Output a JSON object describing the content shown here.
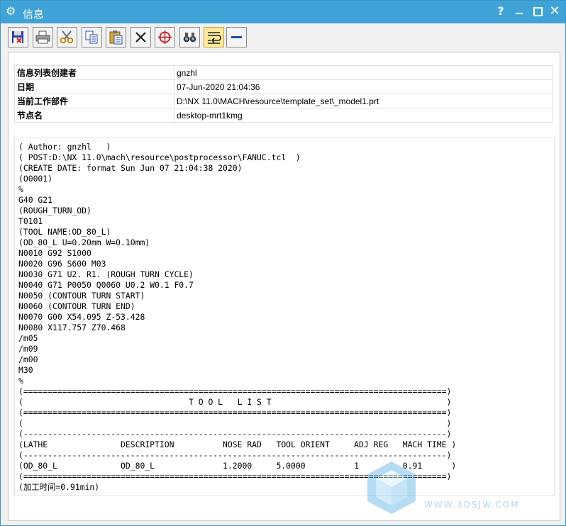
{
  "window": {
    "title": "信息",
    "help_label": "?",
    "close_label": "✕"
  },
  "toolbar": {
    "buttons": [
      {
        "name": "save-button",
        "icon": "floppy-disk-icon"
      },
      {
        "name": "print-button",
        "icon": "printer-icon"
      },
      {
        "name": "cut-button",
        "icon": "scissors-icon"
      },
      {
        "name": "copy-button",
        "icon": "copy-icon"
      },
      {
        "name": "paste-button",
        "icon": "clipboard-icon"
      },
      {
        "name": "delete-button",
        "icon": "x-icon"
      },
      {
        "name": "target-button",
        "icon": "crosshair-icon"
      },
      {
        "name": "find-button",
        "icon": "binoculars-icon"
      },
      {
        "name": "wrap-button",
        "icon": "word-wrap-icon",
        "active": true
      },
      {
        "name": "minimize-panel-button",
        "icon": "minus-icon"
      }
    ]
  },
  "info": {
    "rows": [
      {
        "key": "信息列表创建者",
        "value": "gnzhl"
      },
      {
        "key": "日期",
        "value": "07-Jun-2020 21:04:36"
      },
      {
        "key": "当前工作部件",
        "value": "D:\\NX 11.0\\MACH\\resource\\template_set\\_model1.prt"
      },
      {
        "key": "节点名",
        "value": "desktop-mrt1kmg"
      }
    ]
  },
  "output": {
    "lines": [
      "( Author: gnzhl   )",
      "( POST:D:\\NX 11.0\\mach\\resource\\postprocessor\\FANUC.tcl  )",
      "(CREATE DATE: format Sun Jun 07 21:04:38 2020)",
      "(O0001)",
      "%",
      "G40 G21",
      "(ROUGH_TURN_OD)",
      "T0101",
      "(TOOL NAME:OD_80_L)",
      "(OD_80_L U=0.20mm W=0.10mm)",
      "N0010 G92 S1000",
      "N0020 G96 S600 M03",
      "N0030 G71 U2. R1. (ROUGH TURN CYCLE)",
      "N0040 G71 P0050 Q0060 U0.2 W0.1 F0.7",
      "N0050 (CONTOUR TURN START)",
      "N0060 (CONTOUR TURN END)",
      "N0070 G00 X54.095 Z-53.428",
      "N0080 X117.757 Z70.468",
      "/m05",
      "/m09",
      "/m00",
      "M30",
      "%",
      "(=======================================================================================)",
      "(                                  T O O L   L I S T                                    )",
      "(=======================================================================================)",
      "(                                                                                       )",
      "(---------------------------------------------------------------------------------------)",
      "(LATHE               DESCRIPTION          NOSE RAD   TOOL ORIENT     ADJ REG   MACH TIME )",
      "(---------------------------------------------------------------------------------------)",
      "(OD_80_L             OD_80_L              1.2000     5.0000          1         0.91      )",
      "(=======================================================================================)",
      "(加工时间=0.91min)"
    ]
  },
  "watermark": {
    "text": "WWW.3DSJW.COM"
  }
}
